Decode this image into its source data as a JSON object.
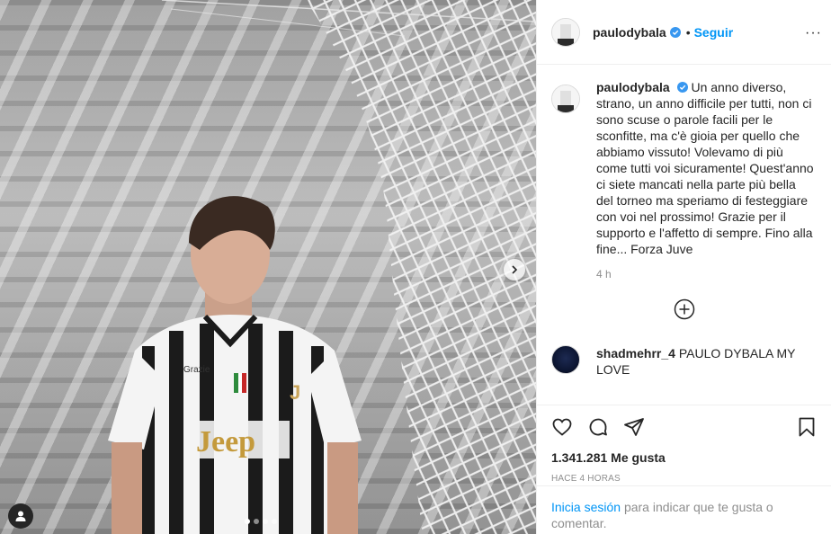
{
  "post": {
    "username": "paulodybala",
    "follow_label": "Seguir",
    "separator": "•"
  },
  "caption": {
    "username": "paulodybala",
    "text": "Un anno diverso, strano, un anno difficile per tutti, non ci sono scuse o parole facili per le sconfitte, ma c'è gioia per quello che abbiamo vissuto! Volevamo di più come tutti voi sicuramente! Quest'anno ci siete mancati nella parte più bella del torneo ma speriamo di festeggiare con voi nel prossimo! Grazie per il supporto e l'affetto di sempre. Fino alla fine... Forza Juve",
    "time": "4 h"
  },
  "comments": [
    {
      "username": "shadmehrr_4",
      "text": "PAULO DYBALA MY LOVE"
    }
  ],
  "stats": {
    "likes": "1.341.281 Me gusta",
    "posted_ago": "HACE 4 HORAS"
  },
  "login_prompt": {
    "link_text": "Inicia sesión",
    "rest_text": "para indicar que te gusta o comentar."
  },
  "shirt": {
    "sponsor": "Jeep",
    "sleeve_text": "Grazie"
  },
  "carousel": {
    "total": 4,
    "active_index": 0
  },
  "icons": {
    "verified": "verified-badge-icon",
    "more": "more-options-icon",
    "like": "heart-icon",
    "comment": "comment-bubble-icon",
    "share": "paper-plane-icon",
    "save": "bookmark-icon",
    "load_more": "plus-circle-icon",
    "next": "chevron-right-icon",
    "tags": "user-tag-icon"
  },
  "colors": {
    "link_blue": "#0095f6",
    "verified_blue": "#3897f0",
    "text": "#262626",
    "muted": "#8e8e8e",
    "border": "#efefef"
  }
}
